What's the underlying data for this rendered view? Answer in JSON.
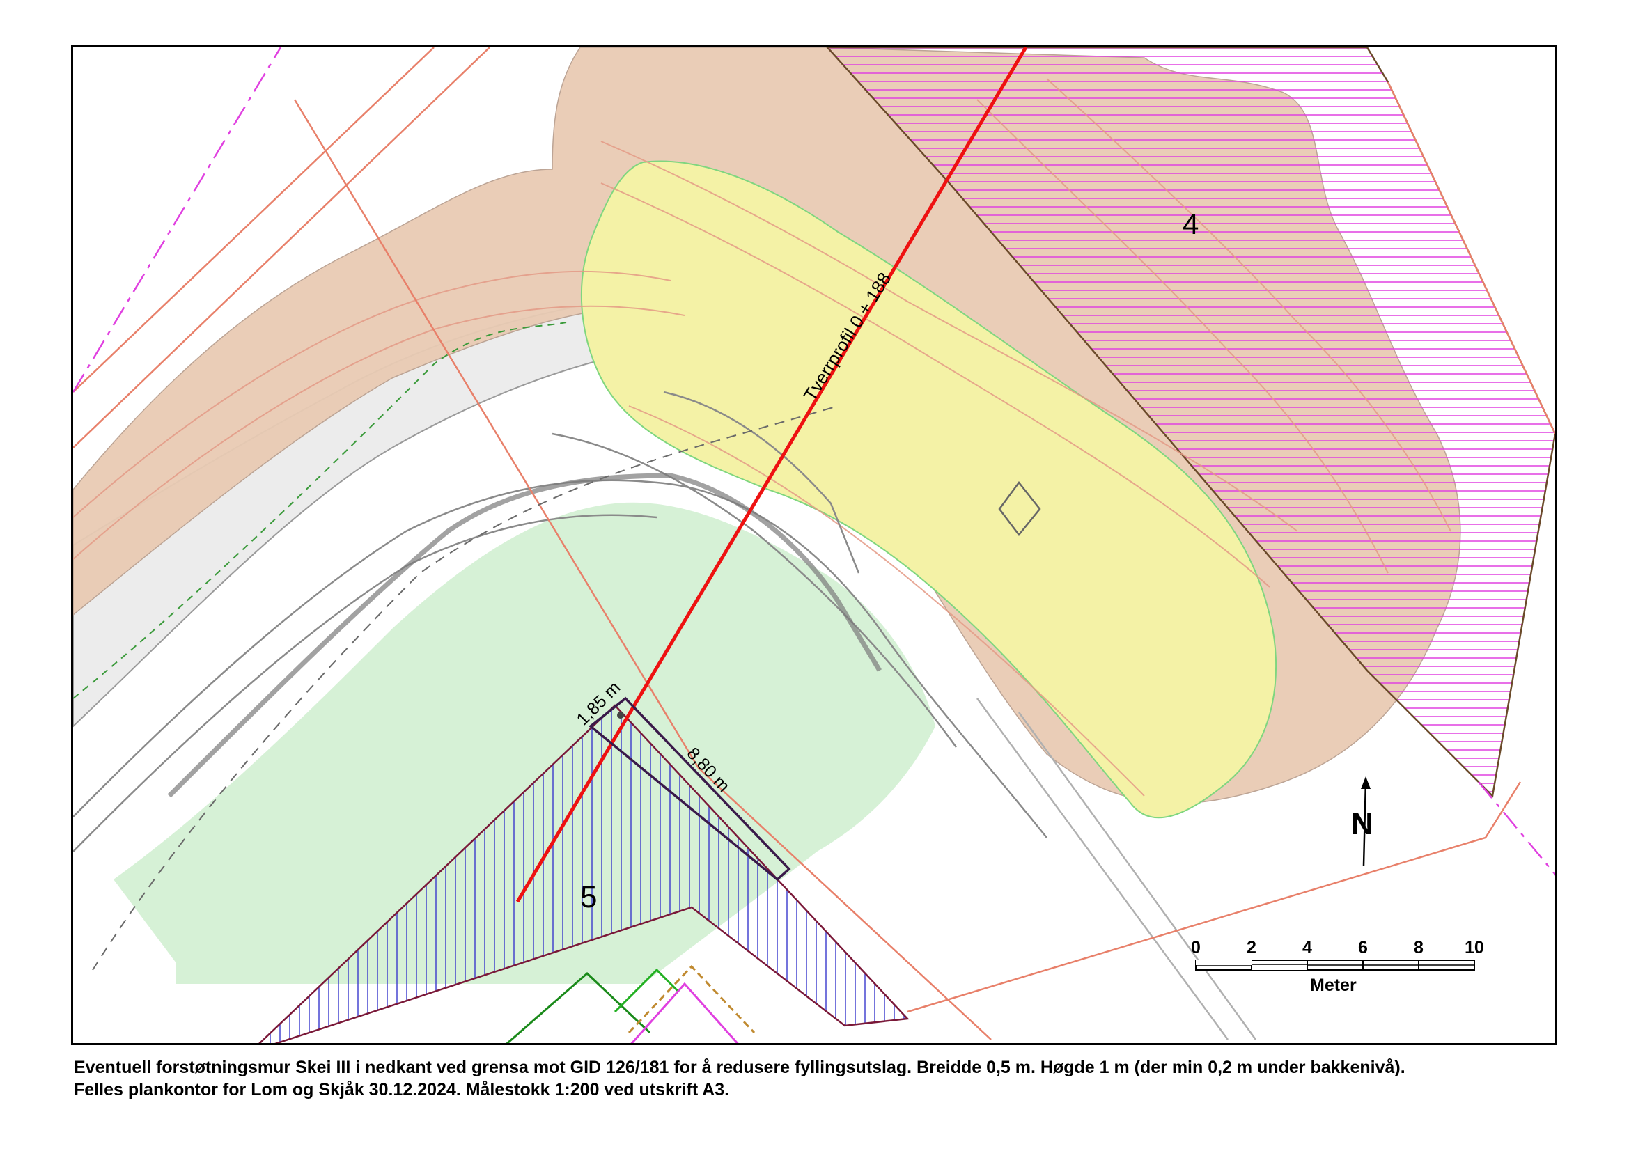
{
  "map": {
    "profile_label": "Tverrprofil 0 + 188",
    "area_labels": {
      "area_4": "4",
      "area_5": "5"
    },
    "dimensions": {
      "width_label": "1,85 m",
      "length_label": "8,80 m"
    },
    "north_label": "N",
    "scale_bar": {
      "ticks": [
        "0",
        "2",
        "4",
        "6",
        "8",
        "10"
      ],
      "unit_label": "Meter"
    },
    "colors": {
      "profile_line": "#ee1111",
      "fill_zone": "#f4f2a6",
      "slope_zone": "#e9cbb4",
      "green_zone": "#d4f0d4",
      "hatch_magenta": "#e040e0",
      "hatch_blue": "#3838cc",
      "boundary_red": "#e8806a"
    }
  },
  "caption": {
    "line1": "Eventuell forstøtningsmur Skei III i nedkant ved grensa mot GID 126/181 for å redusere fyllingsutslag. Breidde 0,5 m. Høgde 1 m (der min 0,2 m under bakkenivå).",
    "line2": "Felles plankontor for Lom og Skjåk 30.12.2024. Målestokk 1:200 ved utskrift A3."
  }
}
